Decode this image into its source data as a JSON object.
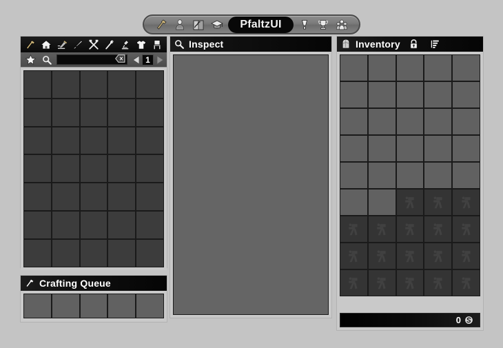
{
  "app": {
    "title": "PfaltzUI",
    "background_color": "#c4c4c4",
    "accent_gold": "#c8b273"
  },
  "topbar": {
    "left_icons": [
      {
        "name": "hammer-icon",
        "label": "Crafting"
      },
      {
        "name": "person-icon",
        "label": "Character"
      },
      {
        "name": "chart-icon",
        "label": "Statistics"
      },
      {
        "name": "graduation-cap-icon",
        "label": "Skills"
      }
    ],
    "right_icons": [
      {
        "name": "medal-icon",
        "label": "Medals"
      },
      {
        "name": "trophy-icon",
        "label": "Trophies"
      },
      {
        "name": "group-icon",
        "label": "Group"
      }
    ]
  },
  "left_panel": {
    "toolbar": [
      {
        "name": "hammer-tool-icon",
        "label": "Smithing",
        "active": true
      },
      {
        "name": "house-icon",
        "label": "Housing",
        "active": false
      },
      {
        "name": "carpentry-icon",
        "label": "Carpentry",
        "active": false
      },
      {
        "name": "dagger-icon",
        "label": "Weapons",
        "active": false
      },
      {
        "name": "crossed-tools-icon",
        "label": "Tools",
        "active": false
      },
      {
        "name": "spoon-icon",
        "label": "Cooking",
        "active": false
      },
      {
        "name": "microscope-icon",
        "label": "Research",
        "active": false
      },
      {
        "name": "shirt-icon",
        "label": "Clothing",
        "active": false
      },
      {
        "name": "furniture-icon",
        "label": "Furniture",
        "active": false
      }
    ],
    "search": {
      "favorite_icon": "star-icon",
      "search_icon": "magnifier-icon",
      "value": "",
      "placeholder": "",
      "clear_icon": "clear-x-icon"
    },
    "pager": {
      "prev_icon": "left-arrow-icon",
      "page": "1",
      "next_icon": "right-arrow-icon",
      "prev_enabled": true,
      "next_enabled": false
    },
    "grid": {
      "columns": 5,
      "rows": 7,
      "slot_state": "empty"
    }
  },
  "crafting_queue": {
    "header_icon": "hammer-icon",
    "title": "Crafting Queue",
    "grid": {
      "columns": 5,
      "rows": 1,
      "slot_state": "empty"
    }
  },
  "inspect": {
    "header_icon": "magnifier-icon",
    "title": "Inspect",
    "body_color": "#656565",
    "content": ""
  },
  "inventory": {
    "header_icon": "backpack-icon",
    "title": "Inventory",
    "actions": [
      {
        "name": "lock-icon",
        "label": "Lock Inventory"
      },
      {
        "name": "sort-list-icon",
        "label": "Sort Inventory"
      }
    ],
    "grid": {
      "columns": 5,
      "rows": 9,
      "slots": [
        "open",
        "open",
        "open",
        "open",
        "open",
        "open",
        "open",
        "open",
        "open",
        "open",
        "open",
        "open",
        "open",
        "open",
        "open",
        "open",
        "open",
        "open",
        "open",
        "open",
        "open",
        "open",
        "open",
        "open",
        "open",
        "open",
        "open",
        "locked",
        "locked",
        "locked",
        "locked",
        "locked",
        "locked",
        "locked",
        "locked",
        "locked",
        "locked",
        "locked",
        "locked",
        "locked",
        "locked",
        "locked",
        "locked",
        "locked",
        "locked"
      ],
      "locked_icon": "runner-locked-icon"
    },
    "money": {
      "amount": "0",
      "currency_icon": "silver-coin-icon",
      "currency_symbol": "S"
    }
  }
}
